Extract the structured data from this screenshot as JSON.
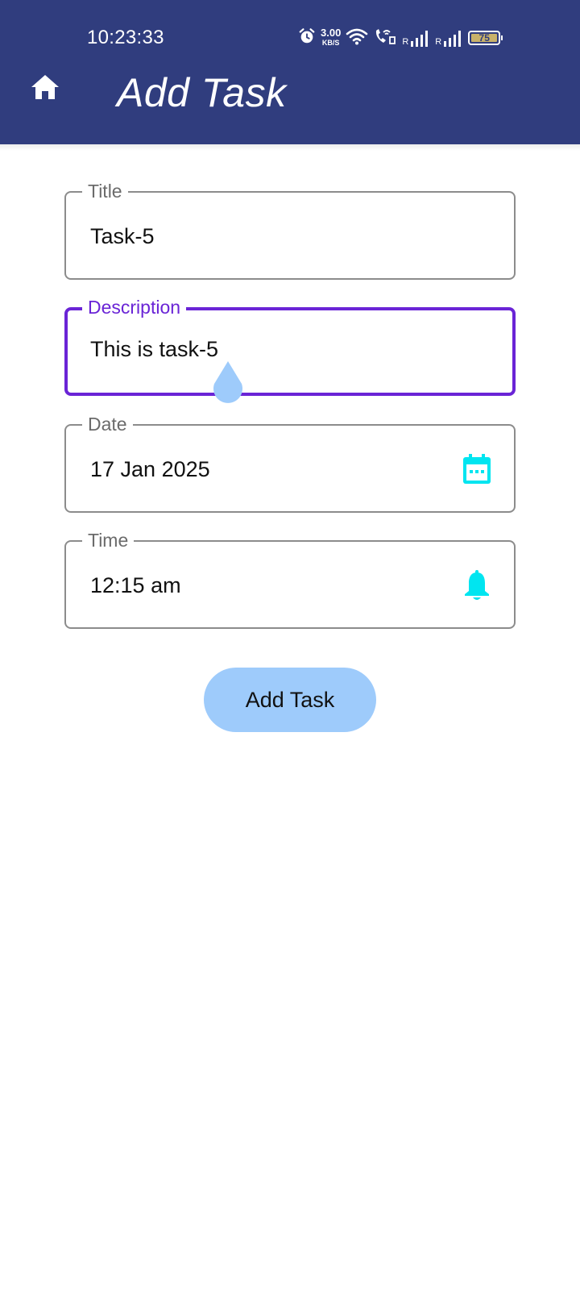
{
  "status_bar": {
    "time": "10:23:33",
    "net_speed_value": "3.00",
    "net_speed_unit": "KB/S",
    "sim1_label": "R",
    "sim2_label": "R",
    "battery": "75",
    "icons": [
      "alarm-icon",
      "wifi-icon",
      "wifi-calling-icon",
      "signal-icon",
      "signal-icon",
      "battery-icon"
    ]
  },
  "app_bar": {
    "title": "Add Task",
    "home_icon": "home-icon",
    "background_color": "#303d7e"
  },
  "form": {
    "title_field": {
      "label": "Title",
      "value": "Task-5"
    },
    "description_field": {
      "label": "Description",
      "value": "This is task-5",
      "focused": true
    },
    "date_field": {
      "label": "Date",
      "value": "17 Jan 2025",
      "icon": "calendar-icon"
    },
    "time_field": {
      "label": "Time",
      "value": "12:15 am",
      "icon": "bell-icon"
    },
    "submit_label": "Add Task"
  },
  "colors": {
    "accent_focus": "#6a24d6",
    "icon_accent": "#00e5f0",
    "button_bg": "#9ecbfb",
    "cursor_handle": "#9ecbfb"
  }
}
